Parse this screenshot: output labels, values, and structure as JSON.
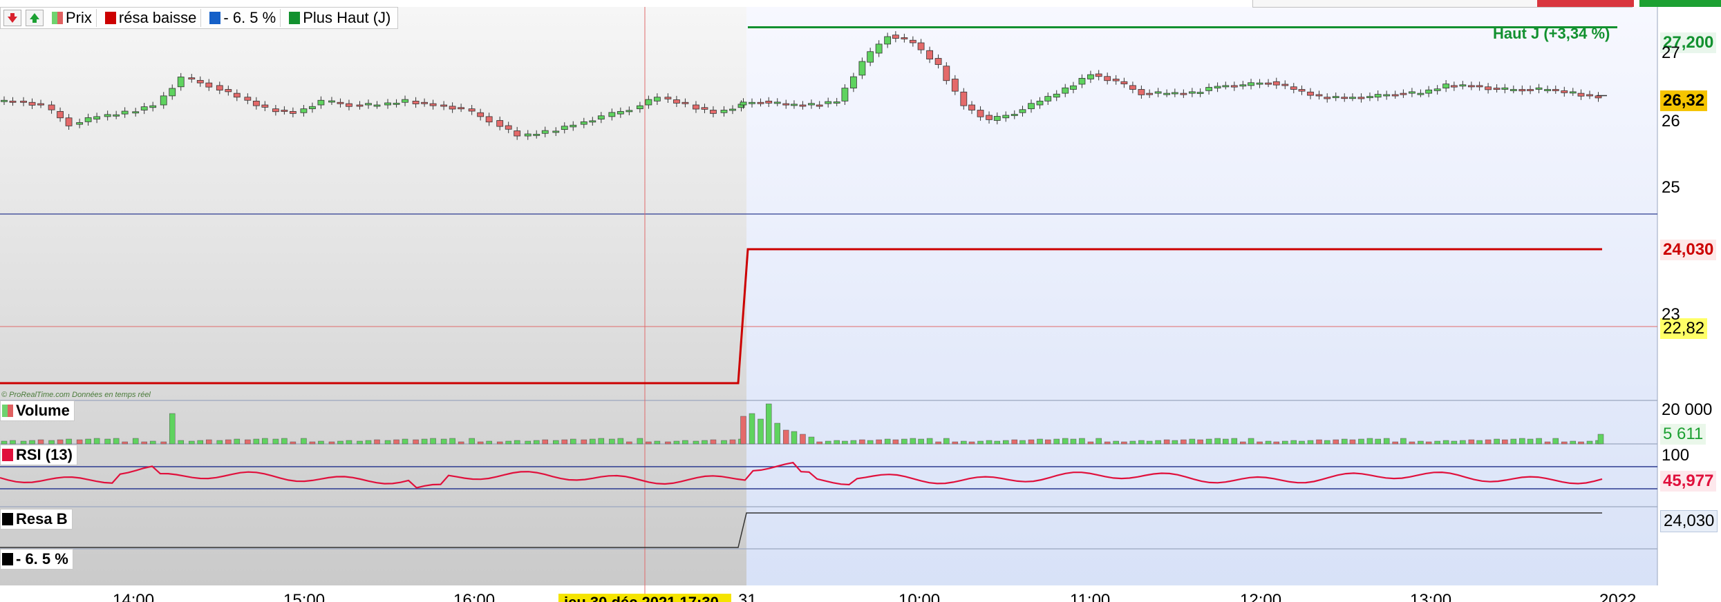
{
  "legend": {
    "items": [
      {
        "label": "Prix",
        "color": "split"
      },
      {
        "label": "résa baisse",
        "color": "#cc0000"
      },
      {
        "label": "- 6. 5 %",
        "color": "#1560c8"
      },
      {
        "label": "Plus Haut (J)",
        "color": "#12912f"
      }
    ]
  },
  "annotations": {
    "haut_j": "Haut J (+3,34 %)",
    "watermark": "© ProRealTime.com  Données en temps réel",
    "cursor_date_partial": "jeu 30 déc 2021 17:30",
    "year_label": "2022"
  },
  "price_axis": {
    "ticks": [
      "27",
      "26",
      "25",
      "23",
      "20 000"
    ],
    "tags": [
      {
        "name": "plus-haut",
        "text": "27,200",
        "color": "#12912f",
        "bg": "#e9f6ec"
      },
      {
        "name": "last-price",
        "text": "26,32",
        "color": "#000000",
        "bg": "#f5c400"
      },
      {
        "name": "resa-baisse",
        "text": "24,030",
        "color": "#cc0000",
        "bg": "#fde8e8"
      },
      {
        "name": "cursor-price",
        "text": "22,82",
        "color": "#000000",
        "bg": "#ffff66"
      }
    ]
  },
  "volume": {
    "label": "Volume",
    "last_value": "5 611",
    "scale_label": "20 000"
  },
  "rsi": {
    "label": "RSI (13)",
    "top_tick": "100",
    "last_value": "45,977"
  },
  "resa_b": {
    "label": "Resa B",
    "value": "24,030"
  },
  "pct_panel": {
    "label": "- 6. 5 %"
  },
  "time_axis": {
    "labels": [
      "14:00",
      "15:00",
      "16:00",
      "31",
      "10:00",
      "11:00",
      "12:00",
      "13:00"
    ]
  },
  "chart_data": {
    "type": "candlestick",
    "title": "",
    "y_range_price": [
      24.0,
      27.3
    ],
    "x_labels": [
      "14:00",
      "15:00",
      "16:00",
      "31",
      "10:00",
      "11:00",
      "12:00",
      "13:00",
      "2022"
    ],
    "sessions": [
      "2021-12-30",
      "2021-12-31"
    ],
    "plus_haut_j": 27.2,
    "resa_baisse": {
      "before": 22.0,
      "after": 24.03
    },
    "last_price": 26.32,
    "cursor_price": 22.82,
    "volume_last": 5611,
    "rsi_last": 45.977,
    "rsi_band": [
      30,
      70
    ],
    "resa_b": 24.03,
    "series": [
      {
        "name": "Prix",
        "close_path": [
          26.25,
          26.2,
          25.95,
          26.05,
          26.1,
          26.2,
          26.55,
          26.45,
          26.3,
          26.15,
          26.1,
          26.25,
          26.2,
          26.2,
          26.25,
          26.2,
          26.15,
          26.0,
          25.8,
          25.85,
          25.95,
          26.05,
          26.15,
          26.3,
          26.2,
          26.1,
          26.2,
          26.25,
          26.2,
          26.2,
          26.25,
          26.75,
          27.1,
          27.0,
          26.7,
          26.2,
          26.0,
          26.1,
          26.25,
          26.4,
          26.6,
          26.5,
          26.35,
          26.35,
          26.35,
          26.45,
          26.45,
          26.5,
          26.4,
          26.3,
          26.3,
          26.3,
          26.35,
          26.35,
          26.45,
          26.45,
          26.4,
          26.4,
          26.4,
          26.35,
          26.3
        ]
      }
    ]
  }
}
